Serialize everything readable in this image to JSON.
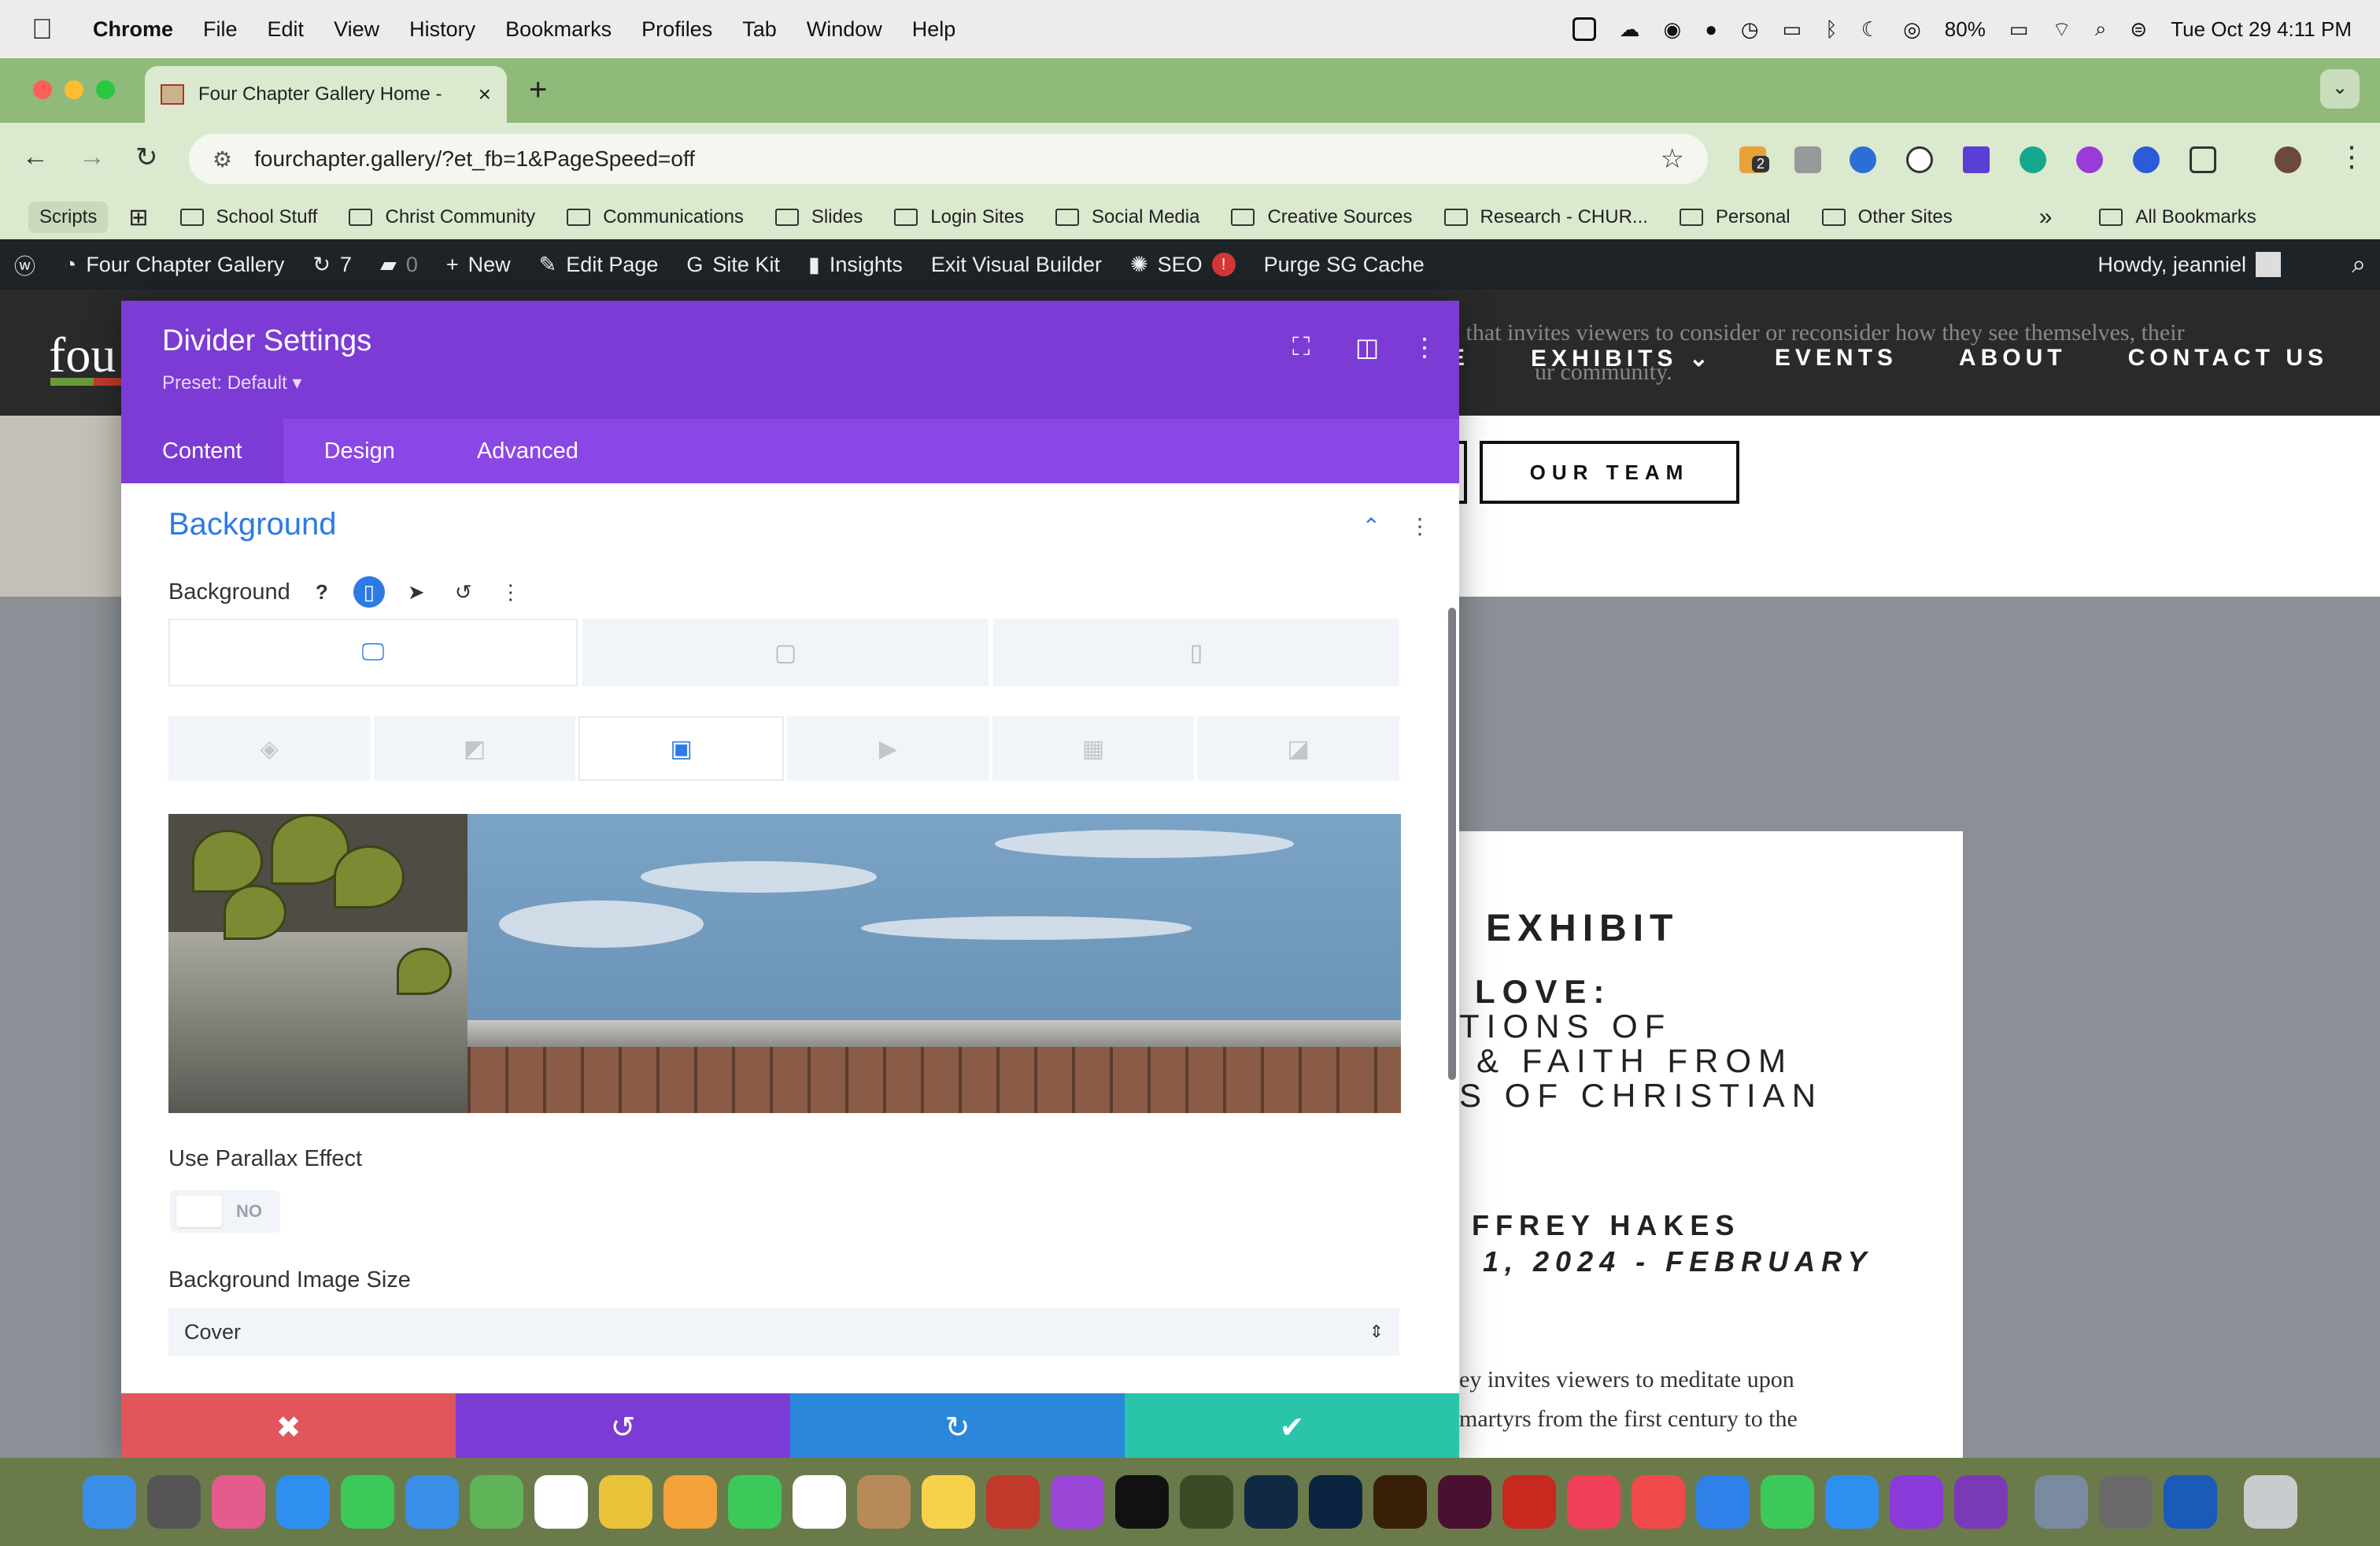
{
  "menubar": {
    "app": "Chrome",
    "items": [
      "File",
      "Edit",
      "View",
      "History",
      "Bookmarks",
      "Profiles",
      "Tab",
      "Window",
      "Help"
    ],
    "battery": "80%",
    "clock": "Tue Oct 29  4:11 PM"
  },
  "browser": {
    "tab_title": "Four Chapter Gallery Home -",
    "url": "fourchapter.gallery/?et_fb=1&PageSpeed=off",
    "ext_badge": "2",
    "bookmarks": [
      "School Stuff",
      "Christ Community",
      "Communications",
      "Slides",
      "Login Sites",
      "Social Media",
      "Creative Sources",
      "Research - CHUR...",
      "Personal",
      "Other Sites"
    ],
    "bookmarks_first": "Scripts",
    "bookmarks_more": "»",
    "all_bookmarks": "All Bookmarks"
  },
  "wpbar": {
    "site": "Four Chapter Gallery",
    "updates": "7",
    "comments": "0",
    "new": "New",
    "edit_page": "Edit Page",
    "site_kit": "Site Kit",
    "insights": "Insights",
    "exit_vb": "Exit Visual Builder",
    "seo": "SEO",
    "seo_badge": "!",
    "purge": "Purge SG Cache",
    "howdy": "Howdy, jeanniel"
  },
  "site": {
    "logo": "fou",
    "intro_1": "k that invites viewers to consider or reconsider how they see themselves, their",
    "intro_2": "ur community.",
    "nav": [
      "OME",
      "EXHIBITS ⌄",
      "EVENTS",
      "ABOUT",
      "CONTACT US"
    ],
    "our_team": "OUR TEAM",
    "exhibit": "EXHIBIT",
    "title_lines": [
      "LOVE:",
      "TIONS OF",
      "& FAITH FROM",
      "S OF CHRISTIAN"
    ],
    "artist": "FFREY HAKES",
    "dates": "1, 2024 - FEBRUARY",
    "desc_1": "ey invites viewers to meditate upon",
    "desc_2": "martyrs from the first century to the"
  },
  "modal": {
    "title": "Divider Settings",
    "preset": "Preset: Default ▾",
    "tabs": [
      "Content",
      "Design",
      "Advanced"
    ],
    "section": "Background",
    "bg_label": "Background",
    "parallax_label": "Use Parallax Effect",
    "parallax_value": "NO",
    "size_label": "Background Image Size",
    "size_value": "Cover"
  },
  "colors": {
    "divi_purple": "#7c3bd4",
    "divi_blue": "#2c7be5",
    "cancel_red": "#e0565b",
    "undo_purple": "#7c3bd4",
    "redo_blue": "#2b87da",
    "save_green": "#29c4a9"
  }
}
